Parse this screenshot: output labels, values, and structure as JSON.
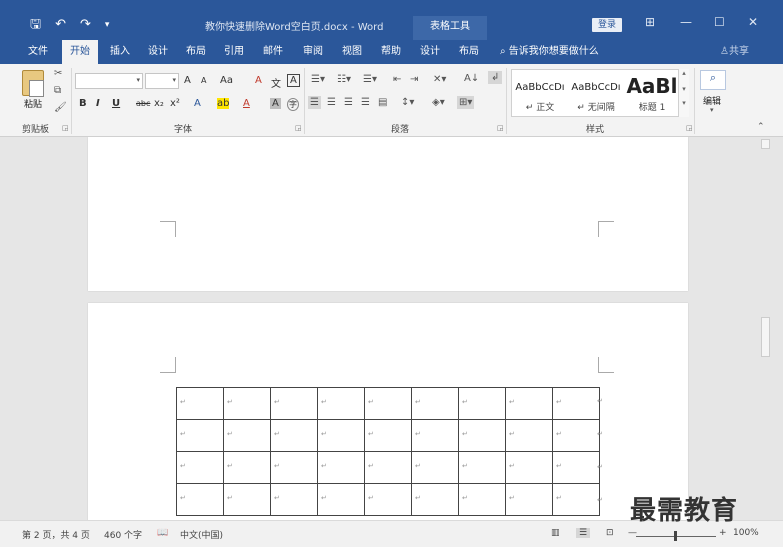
{
  "titlebar": {
    "save_icon": "save-icon",
    "undo_label": "↶",
    "redo_label": "↷",
    "customize_label": "▾",
    "doc_title": "教你快速删除Word空白页.docx - Word",
    "context_tab": "表格工具",
    "login_label": "登录",
    "min_label": "—",
    "max_label": "☐",
    "close_label": "✕",
    "ribbon_display_label": "⊞"
  },
  "tabs": {
    "items": [
      "文件",
      "开始",
      "插入",
      "设计",
      "布局",
      "引用",
      "邮件",
      "审阅",
      "视图",
      "帮助",
      "设计",
      "布局"
    ],
    "active_index": 1,
    "tell_me": "告诉我你想要做什么",
    "share": "共享"
  },
  "ribbon": {
    "clipboard": {
      "paste_label": "粘贴",
      "group_label": "剪贴板"
    },
    "font": {
      "font_name": "",
      "font_size": "",
      "grow": "A",
      "shrink": "A",
      "change_case": "Aa",
      "clear_fmt": "A",
      "phonetic": "文",
      "border_char": "A",
      "bold": "B",
      "italic": "I",
      "underline": "U",
      "strike": "abc",
      "subscript": "x₂",
      "superscript": "x²",
      "text_effect": "A",
      "highlight": "ab",
      "font_color": "A",
      "shade": "A",
      "enclose": "字",
      "group_label": "字体"
    },
    "paragraph": {
      "group_label": "段落",
      "sort": "A↓",
      "marks": "↲"
    },
    "styles": {
      "items": [
        {
          "sample": "AaBbCcDı",
          "name": "↵ 正文"
        },
        {
          "sample": "AaBbCcDı",
          "name": "↵ 无间隔"
        },
        {
          "sample": "AaBl",
          "name": "标题 1"
        }
      ],
      "group_label": "样式"
    },
    "editing": {
      "label": "编辑"
    }
  },
  "document": {
    "table_rows": 4,
    "table_cols": 9,
    "cell_mark": "↵"
  },
  "statusbar": {
    "page": "第 2 页，共 4 页",
    "words": "460 个字",
    "language": "中文(中国)",
    "zoom": "100%",
    "zoom_minus": "—",
    "zoom_plus": "+"
  },
  "watermark": "最需教育",
  "colors": {
    "accent": "#2b579a"
  }
}
